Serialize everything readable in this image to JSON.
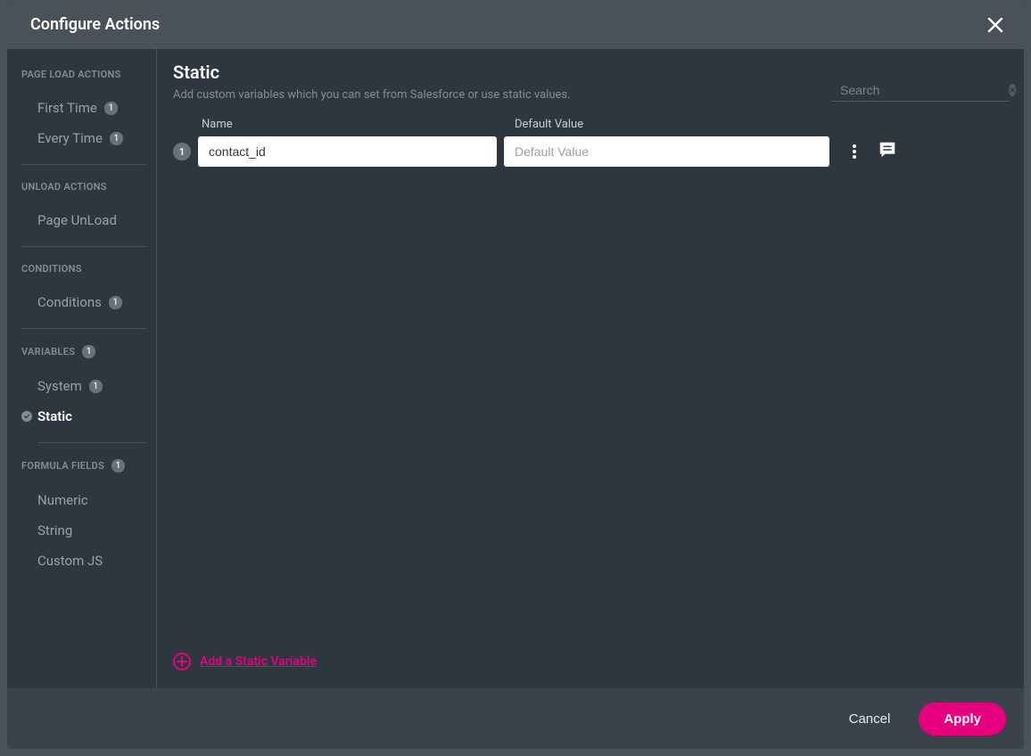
{
  "title": "Configure Actions",
  "sidebar": {
    "groups": [
      {
        "heading": "PAGE LOAD ACTIONS",
        "items": [
          {
            "label": "First Time",
            "badge": "1"
          },
          {
            "label": "Every Time",
            "badge": "1"
          }
        ]
      },
      {
        "heading": "UNLOAD ACTIONS",
        "items": [
          {
            "label": "Page UnLoad"
          }
        ]
      },
      {
        "heading": "CONDITIONS",
        "items": [
          {
            "label": "Conditions",
            "badge": "1"
          }
        ]
      },
      {
        "heading": "VARIABLES",
        "heading_badge": "1",
        "items": [
          {
            "label": "System",
            "badge": "1"
          },
          {
            "label": "Static",
            "active": true
          }
        ]
      },
      {
        "heading": "FORMULA FIELDS",
        "heading_badge": "1",
        "items": [
          {
            "label": "Numeric"
          },
          {
            "label": "String"
          },
          {
            "label": "Custom JS"
          }
        ]
      }
    ]
  },
  "content": {
    "title": "Static",
    "subtitle": "Add custom variables which you can set from Salesforce or use static values.",
    "search_placeholder": "Search",
    "columns": {
      "name": "Name",
      "default_value": "Default Value"
    },
    "rows": [
      {
        "index": "1",
        "name": "contact_id",
        "value": "",
        "value_placeholder": "Default Value"
      }
    ],
    "add_link": "Add a Static Variable"
  },
  "footer": {
    "cancel": "Cancel",
    "apply": "Apply"
  }
}
